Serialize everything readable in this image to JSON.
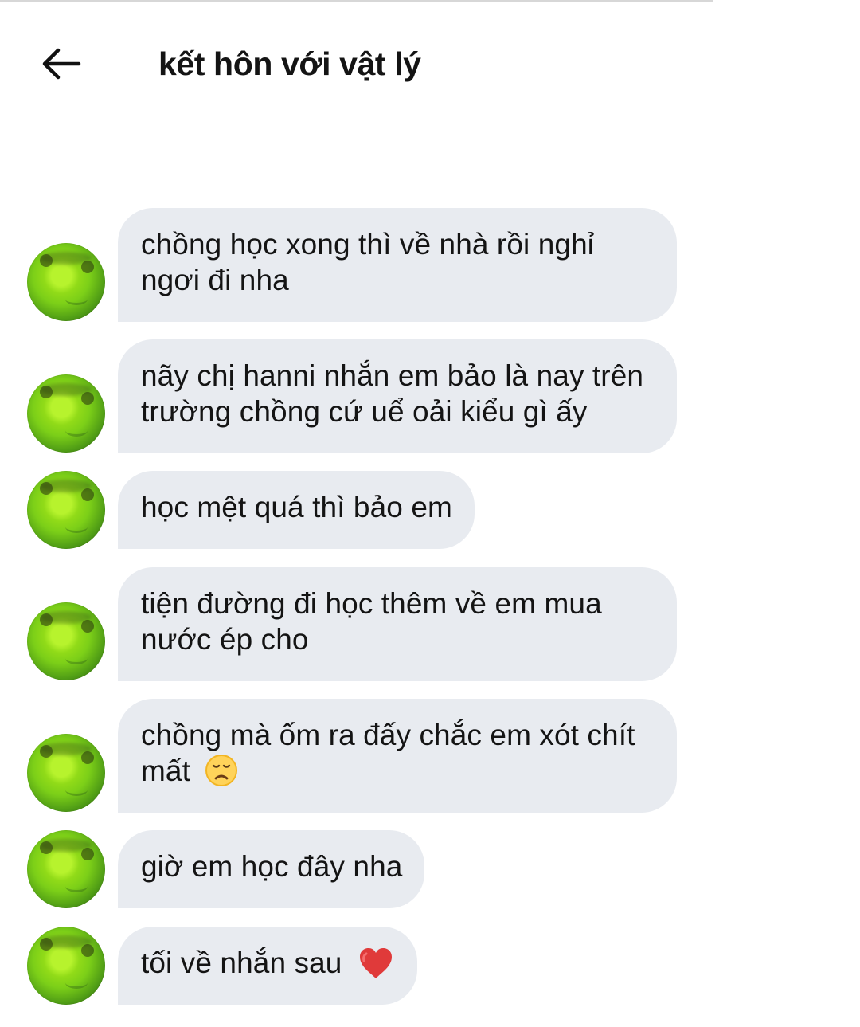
{
  "header": {
    "title": "kết hôn với vật lý",
    "back_icon": "arrow-left-icon"
  },
  "messages": [
    {
      "text": "chồng học xong thì về nhà rồi nghỉ ngơi đi nha"
    },
    {
      "text": "nãy chị hanni nhắn em bảo là nay trên trường chồng cứ uể oải kiểu gì ấy"
    },
    {
      "text": "học mệt quá thì bảo em"
    },
    {
      "text": "tiện đường đi học thêm về em mua nước ép cho"
    },
    {
      "text": "chồng mà ốm ra đấy chắc em xót chít mất",
      "emoji": "disappointed-face-icon"
    },
    {
      "text": "giờ em học đây nha"
    },
    {
      "text": "tối về nhắn sau",
      "emoji": "red-heart-icon"
    }
  ],
  "colors": {
    "background": "#ffffff",
    "bubble": "#e8ebf0",
    "text": "#141414",
    "avatar_green": "#8fdc1a",
    "heart": "#e03a3a"
  }
}
